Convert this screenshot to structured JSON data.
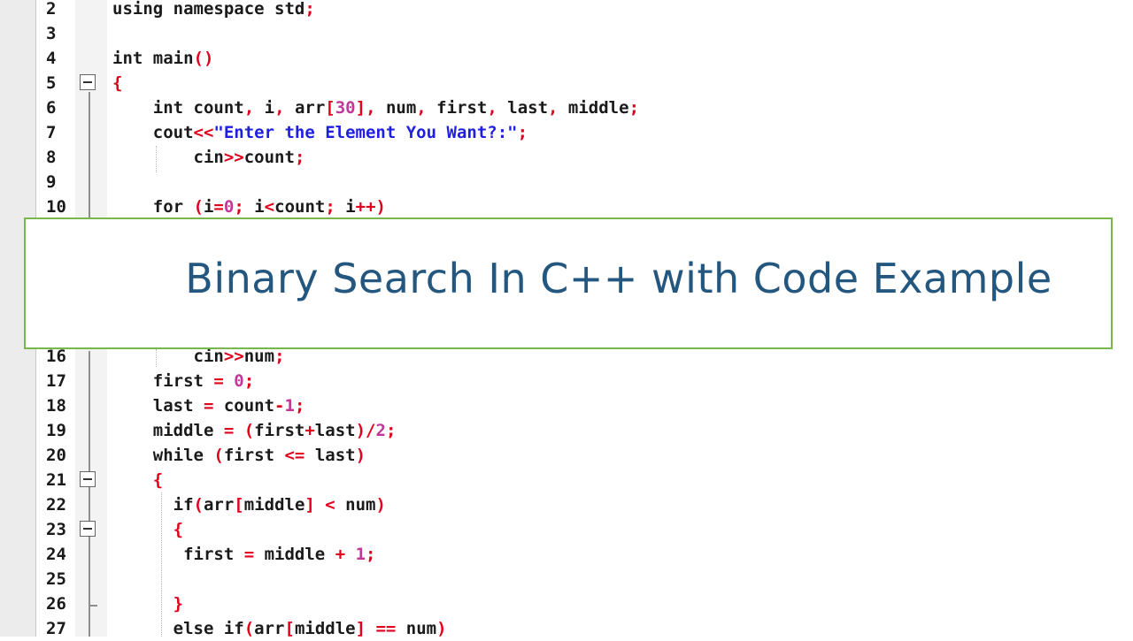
{
  "banner": {
    "title": "Binary Search In C++ with Code Example"
  },
  "editor": {
    "lines": [
      {
        "n": "2",
        "parts": [
          [
            "kw",
            "using namespace std"
          ],
          [
            "op",
            ";"
          ]
        ]
      },
      {
        "n": "3",
        "parts": []
      },
      {
        "n": "4",
        "parts": [
          [
            "kw",
            "int main"
          ],
          [
            "op",
            "()"
          ]
        ]
      },
      {
        "n": "5",
        "parts": [
          [
            "op",
            "{"
          ]
        ]
      },
      {
        "n": "6",
        "parts": [
          [
            "kw",
            "    int count"
          ],
          [
            "op",
            ", "
          ],
          [
            "kw",
            "i"
          ],
          [
            "op",
            ", "
          ],
          [
            "kw",
            "arr"
          ],
          [
            "op",
            "["
          ],
          [
            "num",
            "30"
          ],
          [
            "op",
            "], "
          ],
          [
            "kw",
            "num"
          ],
          [
            "op",
            ", "
          ],
          [
            "kw",
            "first"
          ],
          [
            "op",
            ", "
          ],
          [
            "kw",
            "last"
          ],
          [
            "op",
            ", "
          ],
          [
            "kw",
            "middle"
          ],
          [
            "op",
            ";"
          ]
        ]
      },
      {
        "n": "7",
        "parts": [
          [
            "kw",
            "    cout"
          ],
          [
            "op",
            "<<"
          ],
          [
            "str",
            "\"Enter the Element You Want?:\""
          ],
          [
            "op",
            ";"
          ]
        ]
      },
      {
        "n": "8",
        "parts": [
          [
            "kw",
            "        cin"
          ],
          [
            "op",
            ">>"
          ],
          [
            "kw",
            "count"
          ],
          [
            "op",
            ";"
          ]
        ]
      },
      {
        "n": "9",
        "parts": []
      },
      {
        "n": "10",
        "parts": [
          [
            "kw",
            "    for "
          ],
          [
            "op",
            "("
          ],
          [
            "kw",
            "i"
          ],
          [
            "op",
            "="
          ],
          [
            "num",
            "0"
          ],
          [
            "op",
            "; "
          ],
          [
            "kw",
            "i"
          ],
          [
            "op",
            "<"
          ],
          [
            "kw",
            "count"
          ],
          [
            "op",
            "; "
          ],
          [
            "kw",
            "i"
          ],
          [
            "op",
            "++)"
          ]
        ]
      },
      {
        "n": "16",
        "parts": [
          [
            "kw",
            "        cin"
          ],
          [
            "op",
            ">>"
          ],
          [
            "kw",
            "num"
          ],
          [
            "op",
            ";"
          ]
        ]
      },
      {
        "n": "17",
        "parts": [
          [
            "kw",
            "    first "
          ],
          [
            "op",
            "= "
          ],
          [
            "num",
            "0"
          ],
          [
            "op",
            ";"
          ]
        ]
      },
      {
        "n": "18",
        "parts": [
          [
            "kw",
            "    last "
          ],
          [
            "op",
            "= "
          ],
          [
            "kw",
            "count"
          ],
          [
            "op",
            "-"
          ],
          [
            "num",
            "1"
          ],
          [
            "op",
            ";"
          ]
        ]
      },
      {
        "n": "19",
        "parts": [
          [
            "kw",
            "    middle "
          ],
          [
            "op",
            "= ("
          ],
          [
            "kw",
            "first"
          ],
          [
            "op",
            "+"
          ],
          [
            "kw",
            "last"
          ],
          [
            "op",
            ")/"
          ],
          [
            "num",
            "2"
          ],
          [
            "op",
            ";"
          ]
        ]
      },
      {
        "n": "20",
        "parts": [
          [
            "kw",
            "    while "
          ],
          [
            "op",
            "("
          ],
          [
            "kw",
            "first "
          ],
          [
            "op",
            "<= "
          ],
          [
            "kw",
            "last"
          ],
          [
            "op",
            ")"
          ]
        ]
      },
      {
        "n": "21",
        "parts": [
          [
            "op",
            "    {"
          ]
        ]
      },
      {
        "n": "22",
        "parts": [
          [
            "kw",
            "      if"
          ],
          [
            "op",
            "("
          ],
          [
            "kw",
            "arr"
          ],
          [
            "op",
            "["
          ],
          [
            "kw",
            "middle"
          ],
          [
            "op",
            "] < "
          ],
          [
            "kw",
            "num"
          ],
          [
            "op",
            ")"
          ]
        ]
      },
      {
        "n": "23",
        "parts": [
          [
            "op",
            "      {"
          ]
        ]
      },
      {
        "n": "24",
        "parts": [
          [
            "kw",
            "       first "
          ],
          [
            "op",
            "= "
          ],
          [
            "kw",
            "middle "
          ],
          [
            "op",
            "+ "
          ],
          [
            "num",
            "1"
          ],
          [
            "op",
            ";"
          ]
        ]
      },
      {
        "n": "25",
        "parts": []
      },
      {
        "n": "26",
        "parts": [
          [
            "op",
            "      }"
          ]
        ]
      },
      {
        "n": "27",
        "parts": [
          [
            "kw",
            "      else if"
          ],
          [
            "op",
            "("
          ],
          [
            "kw",
            "arr"
          ],
          [
            "op",
            "["
          ],
          [
            "kw",
            "middle"
          ],
          [
            "op",
            "] == "
          ],
          [
            "kw",
            "num"
          ],
          [
            "op",
            ")"
          ]
        ]
      }
    ]
  }
}
